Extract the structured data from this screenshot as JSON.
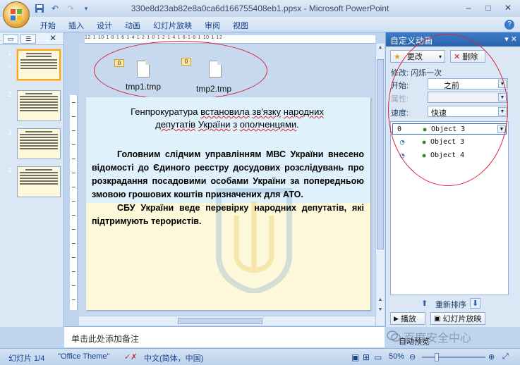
{
  "window": {
    "title": "330e8d23ab82e8a0ca6d166755408eb1.ppsx - Microsoft PowerPoint",
    "controls": [
      "–",
      "□",
      "✕"
    ]
  },
  "ribbon": {
    "tabs": [
      "开始",
      "插入",
      "设计",
      "动画",
      "幻灯片放映",
      "审阅",
      "视图"
    ]
  },
  "thumbnails": {
    "slides": [
      {
        "num": "1",
        "active": true
      },
      {
        "num": "2",
        "active": false
      },
      {
        "num": "3",
        "active": false
      },
      {
        "num": "4",
        "active": false
      }
    ]
  },
  "ruler": {
    "h_text": "12·1·10·1·8·1·6·1·4·1·2·1·0·1·2·1·4·1·6·1·8·1·10·1·12"
  },
  "canvas": {
    "objects": [
      {
        "tag": "0",
        "label": "tmp1.tmp"
      },
      {
        "tag": "0",
        "label": "tmp2.tmp"
      }
    ]
  },
  "slide": {
    "title_plain_1": "Генпрокуратура ",
    "title_u1": "встановила",
    "title_sp": " ",
    "title_u2": "зв'язку",
    "title_plain_2": " ",
    "title_u3": "народних",
    "title_line2_u1": "депутатів",
    "title_line2_sp": " ",
    "title_line2_u2": "України",
    "title_line2_sp2": " ",
    "title_line2_u3": "з",
    "title_line2_sp3": " ",
    "title_line2_u4": "ополченцями",
    "title_line2_end": ".",
    "para1": "Головним слідчим управлінням МВС України внесено відомості до Єдиного реєстру досудових розслідувань про розкрадання посадовими особами України за попередньою змовою грошових коштів призначених для АТО.",
    "para2": "СБУ України веде перевірку народних депутатів, які підтримують терористів."
  },
  "notes": {
    "placeholder": "单击此处添加备注"
  },
  "task_pane": {
    "title": "自定义动画",
    "change_button": "更改",
    "delete_button": "删除",
    "modify_label": "修改: 闪烁一次",
    "start_label": "开始:",
    "start_value": "之前",
    "property_label": "属性:",
    "speed_label": "速度:",
    "speed_value": "快速",
    "animations": [
      {
        "num": "0",
        "name": "Object 3",
        "selected": true
      },
      {
        "num": "",
        "name": "Object 3",
        "selected": false
      },
      {
        "num": "",
        "name": "Object 4",
        "selected": false
      }
    ],
    "reorder_label": "重新排序",
    "play_button": "播放",
    "slideshow_button": "幻灯片放映",
    "autopreview_label": "自动预览"
  },
  "status": {
    "slide_info": "幻灯片 1/4",
    "theme": "\"Office Theme\"",
    "language": "中文(简体，中国)",
    "zoom": "50%"
  },
  "watermark": {
    "text": "百度安全中心"
  },
  "colors": {
    "ellipse_red": "#d9233a",
    "task_header_blue": "#2a61ad",
    "slide_bg": "#fdf8d9"
  }
}
